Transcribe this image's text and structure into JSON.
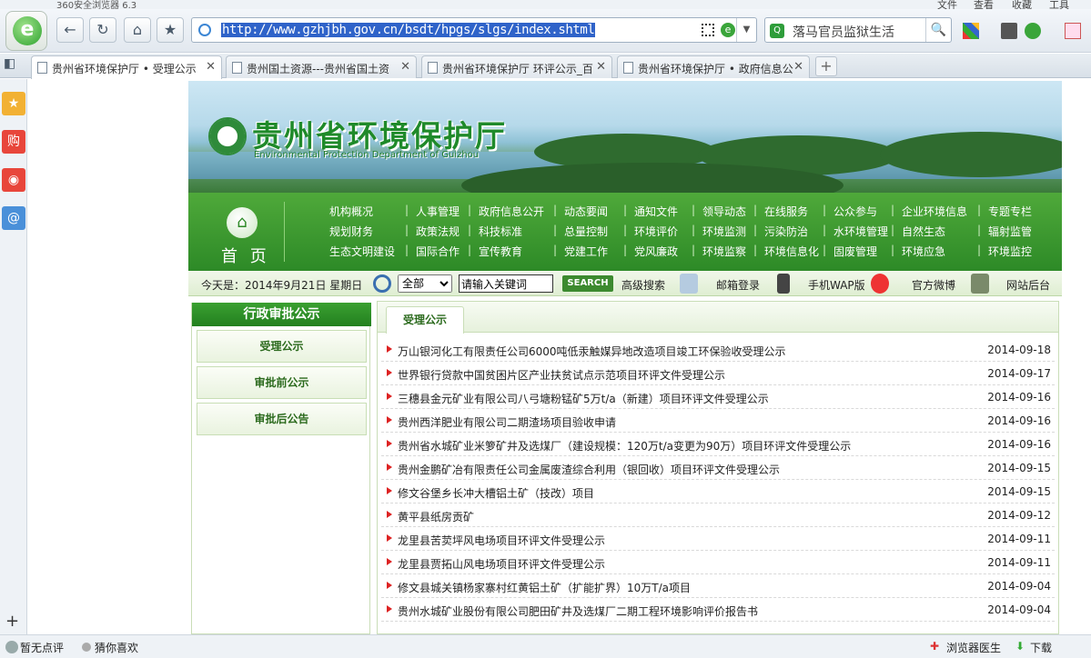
{
  "browser": {
    "app_title": "360安全浏览器 6.3",
    "menu": [
      "文件",
      "查看",
      "收藏",
      "工具"
    ],
    "url": "http://www.gzhjbh.gov.cn/bsdt/hpgs/slgs/index.shtml",
    "search_text": "落马官员监狱生活",
    "tabs": [
      {
        "label": "贵州省环境保护厅 • 受理公示",
        "active": true
      },
      {
        "label": "贵州国土资源---贵州省国土资",
        "active": false
      },
      {
        "label": "贵州省环境保护厅  环评公示_百",
        "active": false
      },
      {
        "label": "贵州省环境保护厅 • 政府信息公",
        "active": false
      }
    ],
    "sidebar_colors": {
      "fav": "#f2b134",
      "shop": "#e8463b",
      "weibo": "#e8463b",
      "mail": "#4a90d9"
    },
    "sidebar_labels": {
      "fav": "★",
      "shop": "购",
      "weibo": "◉",
      "mail": "@"
    }
  },
  "status": {
    "left1": "暂无点评",
    "left2": "猜你喜欢",
    "right1": "浏览器医生",
    "right2": "下载"
  },
  "site": {
    "title": "贵州省环境保护厅",
    "subtitle": "Environmental Protection Department of Guizhou",
    "home_label": "首 页",
    "nav": [
      [
        "机构概况",
        "人事管理",
        "政府信息公开",
        "动态要闻",
        "通知文件",
        "领导动态",
        "在线服务",
        "公众参与",
        "企业环境信息",
        "专题专栏"
      ],
      [
        "规划财务",
        "政策法规",
        "科技标准",
        "总量控制",
        "环境评价",
        "环境监测",
        "污染防治",
        "水环境管理",
        "自然生态",
        "辐射监管"
      ],
      [
        "生态文明建设",
        "国际合作",
        "宣传教育",
        "党建工作",
        "党风廉政",
        "环境监察",
        "环境信息化",
        "固废管理",
        "环境应急",
        "环境监控"
      ]
    ],
    "date_text": "今天是：2014年9月21日  星期日",
    "search_select": "全部",
    "search_input": "请输入关键词",
    "search_button": "SEARCH",
    "links": [
      "高级搜索",
      "邮箱登录",
      "手机WAP版",
      "官方微博",
      "网站后台"
    ],
    "left_title": "行政审批公示",
    "left_items": [
      "受理公示",
      "审批前公示",
      "审批后公告"
    ],
    "right_tab": "受理公示",
    "items": [
      {
        "title": "万山银河化工有限责任公司6000吨低汞触媒异地改造项目竣工环保验收受理公示",
        "date": "2014-09-18"
      },
      {
        "title": "世界银行贷款中国贫困片区产业扶贫试点示范项目环评文件受理公示",
        "date": "2014-09-17"
      },
      {
        "title": "三穗县金元矿业有限公司八弓塘粉锰矿5万t/a（新建）项目环评文件受理公示",
        "date": "2014-09-16"
      },
      {
        "title": "贵州西洋肥业有限公司二期渣场项目验收申请",
        "date": "2014-09-16"
      },
      {
        "title": "贵州省水城矿业米箩矿井及选煤厂（建设规模：120万t/a变更为90万）项目环评文件受理公示",
        "date": "2014-09-16"
      },
      {
        "title": "贵州金鹏矿冶有限责任公司金属废渣综合利用（银回收）项目环评文件受理公示",
        "date": "2014-09-15"
      },
      {
        "title": "修文谷堡乡长冲大槽铝土矿（技改）项目",
        "date": "2014-09-15"
      },
      {
        "title": "黄平县纸房贡矿",
        "date": "2014-09-12"
      },
      {
        "title": "龙里县苦荬坪风电场项目环评文件受理公示",
        "date": "2014-09-11"
      },
      {
        "title": "龙里县贾拓山风电场项目环评文件受理公示",
        "date": "2014-09-11"
      },
      {
        "title": "修文县城关镇杨家寨村红黄铝土矿（扩能扩界）10万T/a项目",
        "date": "2014-09-04"
      },
      {
        "title": "贵州水城矿业股份有限公司肥田矿井及选煤厂二期工程环境影响评价报告书",
        "date": "2014-09-04"
      }
    ]
  }
}
